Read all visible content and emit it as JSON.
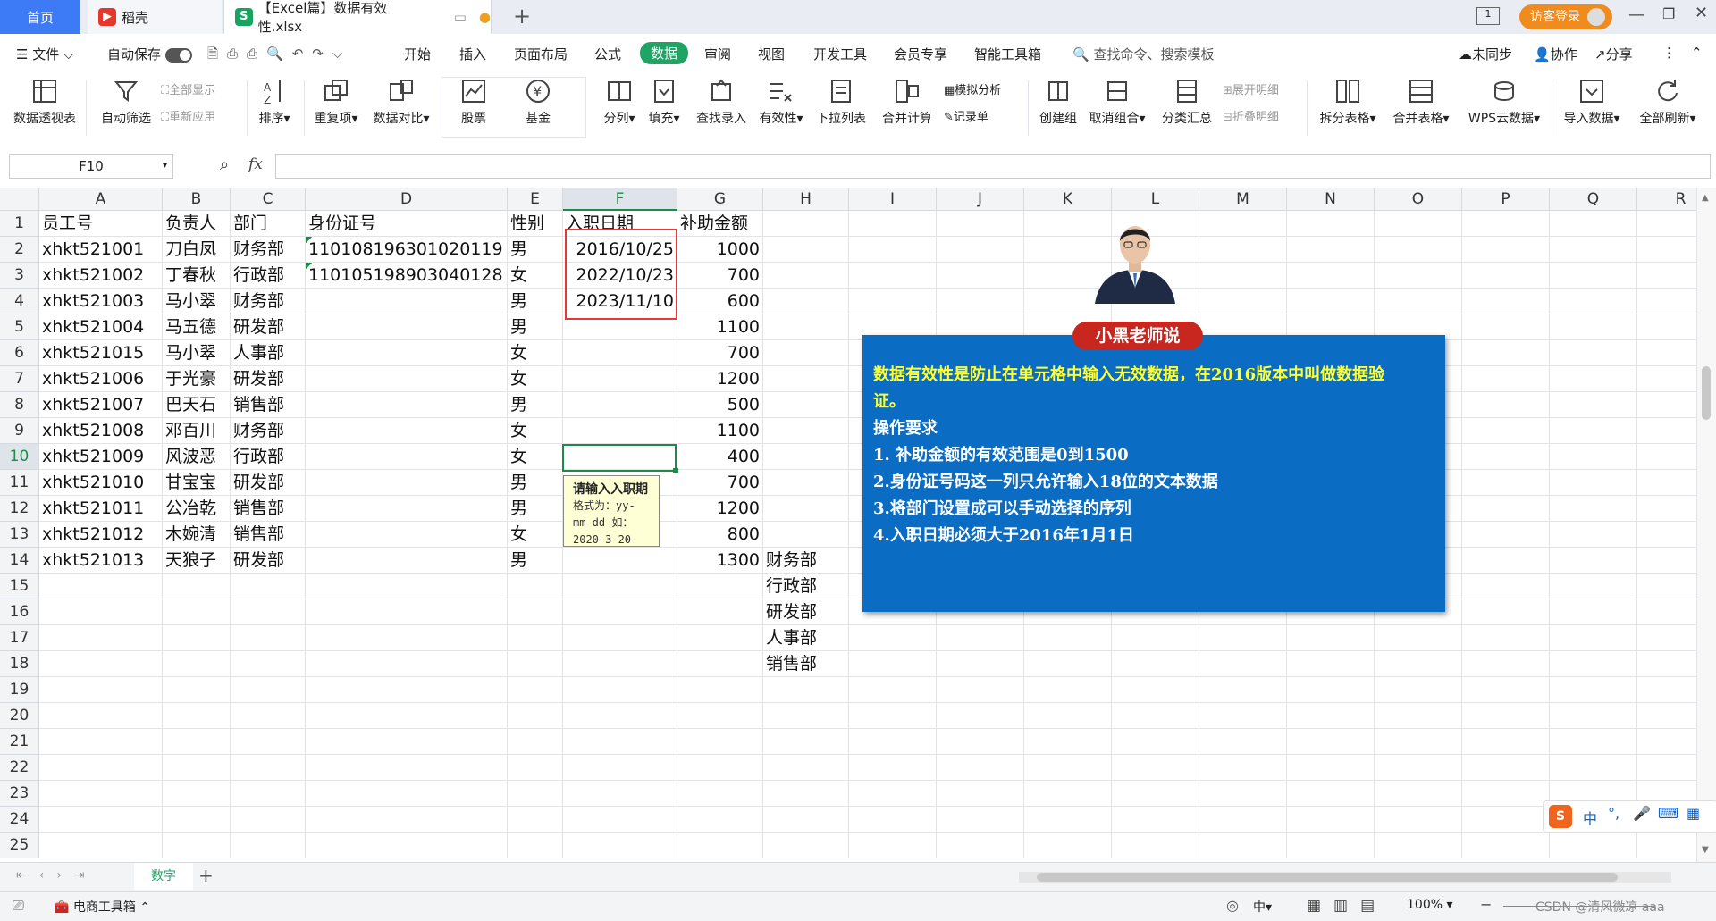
{
  "tabs": {
    "home": "首页",
    "daoke": "稻壳",
    "file": "【Excel篇】数据有效性.xlsx",
    "guest": "访客登录"
  },
  "menubar": {
    "file": "文件",
    "autosave": "自动保存",
    "items": [
      "开始",
      "插入",
      "页面布局",
      "公式",
      "数据",
      "审阅",
      "视图",
      "开发工具",
      "会员专享",
      "智能工具箱"
    ],
    "active": "数据",
    "search": "查找命令、搜索模板",
    "sync": "未同步",
    "collab": "协作",
    "share": "分享"
  },
  "ribbon": {
    "pivot": "数据透视表",
    "autofilter": "自动筛选",
    "showall": "全部显示",
    "reapply": "重新应用",
    "sort": "排序",
    "dup": "重复项",
    "compare": "数据对比",
    "stock": "股票",
    "fund": "基金",
    "split": "分列",
    "fill": "填充",
    "lookup": "查找录入",
    "validity": "有效性",
    "dropdown": "下拉列表",
    "consolidate": "合并计算",
    "whatif": "模拟分析",
    "record": "记录单",
    "group": "创建组",
    "ungroup": "取消组合",
    "subtotal": "分类汇总",
    "expand": "展开明细",
    "collapse": "折叠明细",
    "splittable": "拆分表格",
    "mergetable": "合并表格",
    "wpsdata": "WPS云数据",
    "import": "导入数据",
    "refresh": "全部刷新"
  },
  "formula": {
    "namebox": "F10",
    "fx": "fx",
    "content": ""
  },
  "columns": [
    "A",
    "B",
    "C",
    "D",
    "E",
    "F",
    "G",
    "H",
    "I",
    "J",
    "K",
    "L",
    "M",
    "N",
    "O",
    "P",
    "Q",
    "R"
  ],
  "rows": [
    "1",
    "2",
    "3",
    "4",
    "5",
    "6",
    "7",
    "8",
    "9",
    "10",
    "11",
    "12",
    "13",
    "14",
    "15",
    "16",
    "17",
    "18",
    "19",
    "20",
    "21",
    "22",
    "23",
    "24",
    "25"
  ],
  "table": {
    "header": [
      "员工号",
      "负责人",
      "部门",
      "身份证号",
      "性别",
      "入职日期",
      "补助金额"
    ],
    "data": [
      [
        "xhkt521001",
        "刀白凤",
        "财务部",
        "110108196301020119",
        "男",
        "2016/10/25",
        "1000"
      ],
      [
        "xhkt521002",
        "丁春秋",
        "行政部",
        "110105198903040128",
        "女",
        "2022/10/23",
        "700"
      ],
      [
        "xhkt521003",
        "马小翠",
        "财务部",
        "",
        "男",
        "2023/11/10",
        "600"
      ],
      [
        "xhkt521004",
        "马五德",
        "研发部",
        "",
        "男",
        "",
        "1100"
      ],
      [
        "xhkt521015",
        "马小翠",
        "人事部",
        "",
        "女",
        "",
        "700"
      ],
      [
        "xhkt521006",
        "于光豪",
        "研发部",
        "",
        "女",
        "",
        "1200"
      ],
      [
        "xhkt521007",
        "巴天石",
        "销售部",
        "",
        "男",
        "",
        "500"
      ],
      [
        "xhkt521008",
        "邓百川",
        "财务部",
        "",
        "女",
        "",
        "1100"
      ],
      [
        "xhkt521009",
        "风波恶",
        "行政部",
        "",
        "女",
        "",
        "400"
      ],
      [
        "xhkt521010",
        "甘宝宝",
        "研发部",
        "",
        "男",
        "",
        "700"
      ],
      [
        "xhkt521011",
        "公冶乾",
        "销售部",
        "",
        "男",
        "",
        "1200"
      ],
      [
        "xhkt521012",
        "木婉清",
        "销售部",
        "",
        "女",
        "",
        "800"
      ],
      [
        "xhkt521013",
        "天狼子",
        "研发部",
        "",
        "男",
        "",
        "1300"
      ]
    ],
    "h_list": [
      "财务部",
      "行政部",
      "研发部",
      "人事部",
      "销售部"
    ]
  },
  "tooltip": {
    "title": "请输入入职期",
    "body": "格式为：yy-mm-dd 如：2020-3-20"
  },
  "note": {
    "badge": "小黑老师说",
    "lines": [
      "数据有效性是防止在单元格中输入无效数据，在2016版本中叫做数据验",
      "证。",
      "操作要求",
      "1. 补助金额的有效范围是0到1500",
      "2.身份证号码这一列只允许输入18位的文本数据",
      "3.将部门设置成可以手动选择的序列",
      "4.入职日期必须大于2016年1月1日"
    ]
  },
  "sheet": {
    "name": "数字"
  },
  "status": {
    "toolbox": "电商工具箱",
    "input": "中",
    "zoom": "100%",
    "watermark": "CSDN @清风微凉 aaa"
  },
  "ime": {
    "lang": "中"
  },
  "colors": {
    "accent": "#21a366",
    "note_bg": "#0a6cc2",
    "note_text": "#ffff33",
    "badge": "#c8271f",
    "highlight": "#e53935"
  }
}
